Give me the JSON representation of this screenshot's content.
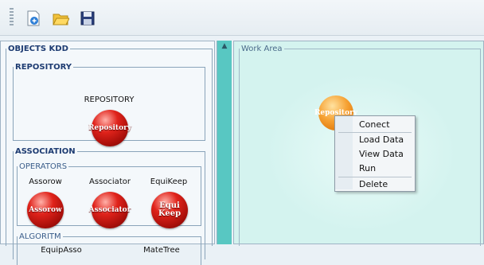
{
  "toolbar": {
    "buttons": [
      {
        "name": "new-document-icon"
      },
      {
        "name": "open-folder-icon"
      },
      {
        "name": "save-disk-icon"
      }
    ]
  },
  "left_panel": {
    "title": "OBJECTS KDD",
    "repository_group": {
      "title": "REPOSITORY",
      "items": [
        {
          "label": "REPOSITORY",
          "orb": "Repository"
        }
      ]
    },
    "association_group": {
      "title": "ASSOCIATION",
      "operators": {
        "title": "OPERATORS",
        "items": [
          {
            "label": "Assorow",
            "orb": "Assorow"
          },
          {
            "label": "Associator",
            "orb": "Associator"
          },
          {
            "label": "EquiKeep",
            "orb": "Equi Keep"
          }
        ]
      },
      "algoritm": {
        "title": "ALGORITM",
        "items": [
          {
            "label": "EquipAsso"
          },
          {
            "label": "MateTree"
          }
        ]
      }
    }
  },
  "work_area": {
    "title": "Work Area",
    "node": {
      "label": "Repository"
    },
    "context_menu": [
      "Conect",
      "Load Data",
      "View Data",
      "Run",
      "Delete"
    ]
  },
  "colors": {
    "accent_teal": "#58c7c2",
    "workspace_bg": "#d4f3ef",
    "orb_red": "#e0231b",
    "node_orange": "#f6a234"
  }
}
